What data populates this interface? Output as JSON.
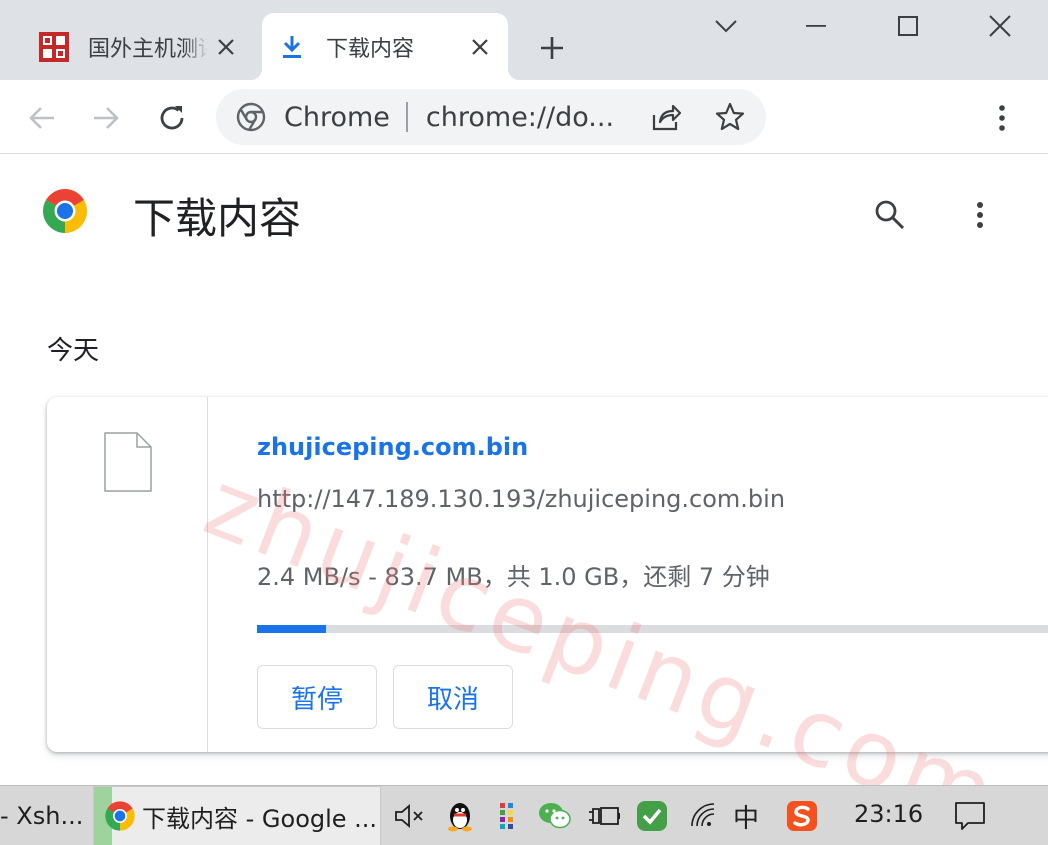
{
  "tabs": [
    {
      "title": "国外主机测评",
      "favicon": "site-favicon-icon",
      "active": false
    },
    {
      "title": "下载内容",
      "favicon": "download-icon",
      "active": true
    }
  ],
  "omnibox": {
    "site_chip": "Chrome",
    "url": "chrome://do..."
  },
  "page": {
    "title": "下载内容",
    "date_header": "今天"
  },
  "download": {
    "file_name": "zhujiceping.com.bin",
    "url": "http://147.189.130.193/zhujiceping.com.bin",
    "status": "2.4 MB/s - 83.7 MB，共 1.0 GB，还剩 7 分钟",
    "progress_fraction": 0.0817,
    "pause_label": "暂停",
    "cancel_label": "取消"
  },
  "watermark": "zhujiceping.com",
  "taskbar": {
    "items": [
      {
        "label": "- Xsh..."
      },
      {
        "label": "下载内容 - Google ..."
      }
    ],
    "ime": "中",
    "clock": "23:16"
  },
  "colors": {
    "accent": "#1a73e8",
    "tabstrip": "#dee1e6",
    "taskbar": "#d7d7d7"
  }
}
